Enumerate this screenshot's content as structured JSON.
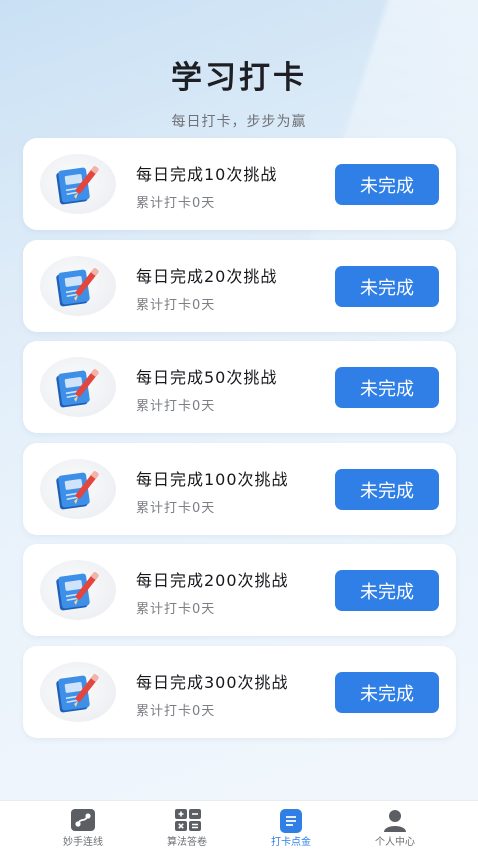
{
  "header": {
    "title": "学习打卡",
    "subtitle": "每日打卡，步步为赢"
  },
  "challenges": [
    {
      "title": "每日完成10次挑战",
      "progress": "累计打卡0天",
      "status": "未完成"
    },
    {
      "title": "每日完成20次挑战",
      "progress": "累计打卡0天",
      "status": "未完成"
    },
    {
      "title": "每日完成50次挑战",
      "progress": "累计打卡0天",
      "status": "未完成"
    },
    {
      "title": "每日完成100次挑战",
      "progress": "累计打卡0天",
      "status": "未完成"
    },
    {
      "title": "每日完成200次挑战",
      "progress": "累计打卡0天",
      "status": "未完成"
    },
    {
      "title": "每日完成300次挑战",
      "progress": "累计打卡0天",
      "status": "未完成"
    }
  ],
  "tabbar": {
    "tabs": [
      {
        "label": "妙手连线",
        "icon": "link-icon",
        "active": false
      },
      {
        "label": "算法答卷",
        "icon": "calculator-icon",
        "active": false
      },
      {
        "label": "打卡点金",
        "icon": "checkin-doc-icon",
        "active": true
      },
      {
        "label": "个人中心",
        "icon": "user-icon",
        "active": false
      }
    ]
  },
  "colors": {
    "accent": "#2f7fe6",
    "inactive_tab": "#5b5e63"
  }
}
